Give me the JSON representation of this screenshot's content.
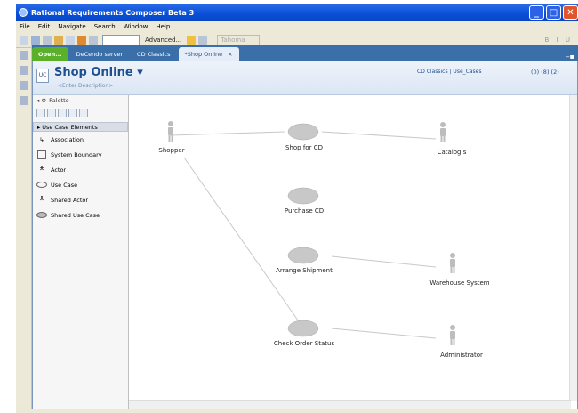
{
  "window": {
    "title": "Rational Requirements Composer Beta 3"
  },
  "menu": [
    "File",
    "Edit",
    "Navigate",
    "Search",
    "Window",
    "Help"
  ],
  "toolbar": {
    "advanced": "Advanced...",
    "font": "Tahoma"
  },
  "tabs": [
    {
      "label": "Open..."
    },
    {
      "label": "DeCendo server"
    },
    {
      "label": "CD Classics"
    },
    {
      "label": "*Shop Online"
    }
  ],
  "editor": {
    "title": "Shop Online",
    "description": "<Enter Description>",
    "breadcrumb": "CD Classics | Use_Cases",
    "counts": "(0) (8) (2)"
  },
  "palette": {
    "title": "Palette",
    "section": "Use Case Elements",
    "items": [
      "Association",
      "System Boundary",
      "Actor",
      "Use Case",
      "Shared Actor",
      "Shared Use Case"
    ]
  },
  "diagram": {
    "actors": [
      "Shopper",
      "Catalog s",
      "Warehouse System",
      "Administrator"
    ],
    "usecases": [
      "Shop for CD",
      "Purchase CD",
      "Arrange Shipment",
      "Check Order Status"
    ]
  }
}
